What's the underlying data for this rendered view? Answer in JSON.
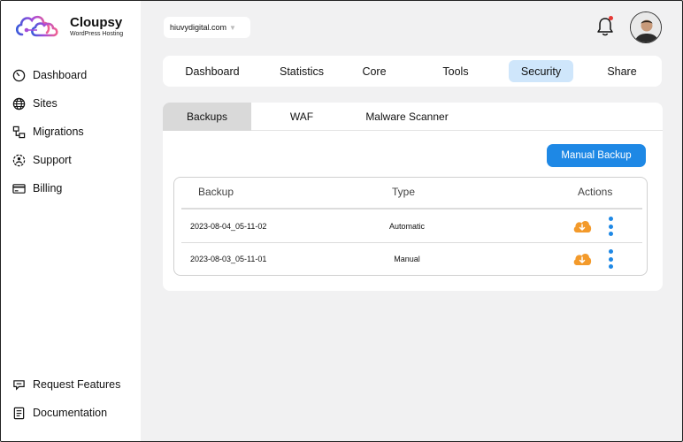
{
  "brand": {
    "name": "Cloupsy",
    "tagline": "WordPress Hosting"
  },
  "sidebar": {
    "items": [
      {
        "label": "Dashboard",
        "icon": "speedometer-icon"
      },
      {
        "label": "Sites",
        "icon": "globe-icon"
      },
      {
        "label": "Migrations",
        "icon": "migration-icon"
      },
      {
        "label": "Support",
        "icon": "support-icon"
      },
      {
        "label": "Billing",
        "icon": "credit-card-icon"
      }
    ],
    "bottom": [
      {
        "label": "Request Features",
        "icon": "feature-request-icon"
      },
      {
        "label": "Documentation",
        "icon": "document-icon"
      }
    ]
  },
  "header": {
    "domain": "hiuvydigital.com",
    "notification_dot_color": "#e53935"
  },
  "topnav": {
    "tabs": [
      {
        "label": "Dashboard"
      },
      {
        "label": "Statistics"
      },
      {
        "label": "Core"
      },
      {
        "label": "Tools"
      },
      {
        "label": "Security",
        "active": true
      },
      {
        "label": "Share"
      }
    ]
  },
  "security": {
    "subtabs": [
      {
        "label": "Backups",
        "active": true
      },
      {
        "label": "WAF"
      },
      {
        "label": "Malware Scanner"
      }
    ],
    "manual_backup_label": "Manual Backup",
    "table": {
      "headers": {
        "backup": "Backup",
        "type": "Type",
        "actions": "Actions"
      },
      "rows": [
        {
          "backup": "2023-08-04_05-11-02",
          "type": "Automatic"
        },
        {
          "backup": "2023-08-03_05-11-01",
          "type": "Manual"
        }
      ]
    }
  },
  "colors": {
    "accent": "#1e88e5",
    "active_tab_bg": "#cfe6fb",
    "download_orange": "#f39a2b"
  }
}
